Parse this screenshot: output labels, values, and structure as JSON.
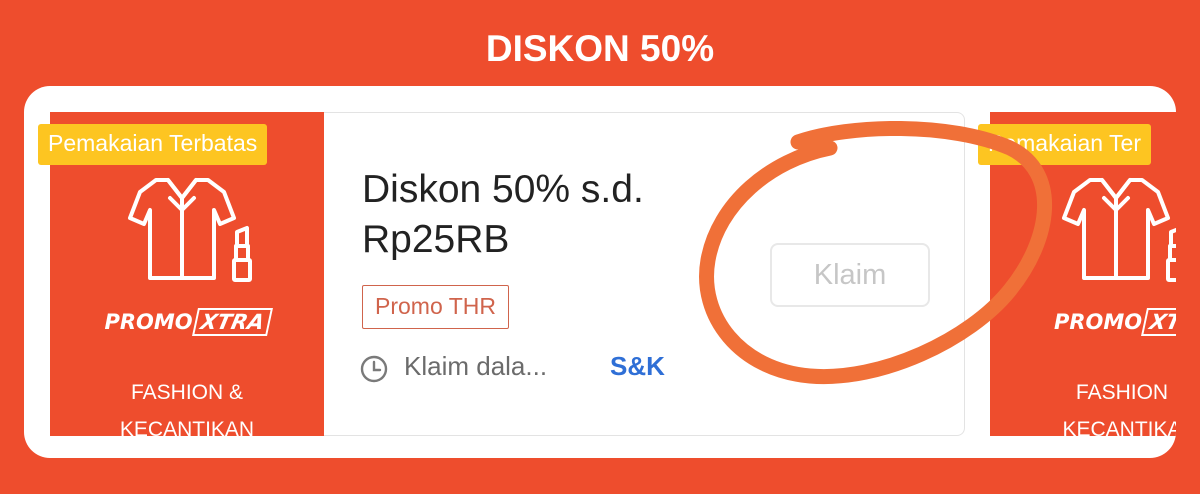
{
  "header": {
    "title": "DISKON 50%"
  },
  "vouchers": [
    {
      "limited_label": "Pemakaian Terbatas",
      "icon": "shirt-and-lipstick-icon",
      "promo_brand": "PROMO",
      "promo_brand_badge": "XTRA",
      "category_line1": "FASHION &",
      "category_line2": "KECANTIKAN",
      "title": "Diskon 50% s.d. Rp25RB",
      "tag": "Promo THR",
      "validity": "Klaim dala...",
      "terms": "S&K",
      "claim_label": "Klaim"
    },
    {
      "limited_label": "Pemakaian Ter",
      "icon": "shirt-and-lipstick-icon",
      "promo_brand": "PROMO",
      "promo_brand_badge": "XTR",
      "category_line1": "FASHION",
      "category_line2": "KECANTIKA"
    }
  ],
  "colors": {
    "brand": "#ee4d2d",
    "limited_tag": "#fdc521",
    "link": "#2f6fd6",
    "annotation": "#f07038"
  }
}
